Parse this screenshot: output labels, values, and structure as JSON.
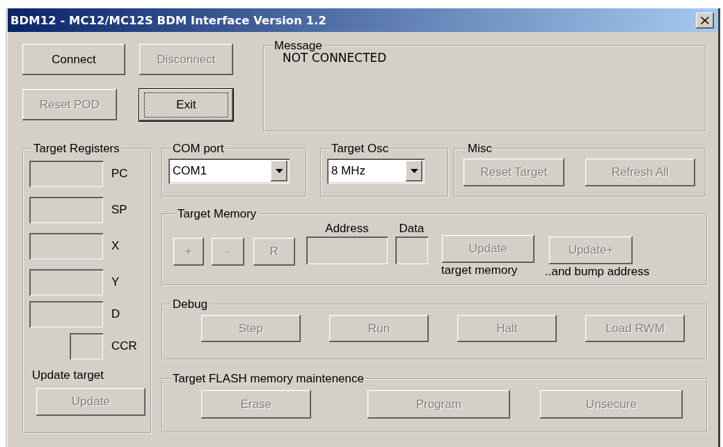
{
  "window": {
    "title": "BDM12 - MC12/MC12S BDM Interface Version 1.2"
  },
  "connection_buttons": [
    {
      "label": "Connect",
      "disabled": false,
      "focused": false
    },
    {
      "label": "Disconnect",
      "disabled": true,
      "focused": false
    },
    {
      "label": "Reset POD",
      "disabled": true,
      "focused": false
    },
    {
      "label": "Exit",
      "disabled": false,
      "focused": true
    }
  ],
  "message": {
    "title": "Message",
    "text": "NOT CONNECTED"
  },
  "target_registers": {
    "title": "Target Registers",
    "registers": [
      {
        "label": "PC",
        "kind": "word"
      },
      {
        "label": "SP",
        "kind": "word"
      },
      {
        "label": "X",
        "kind": "word"
      },
      {
        "label": "Y",
        "kind": "word"
      },
      {
        "label": "D",
        "kind": "word"
      },
      {
        "label": "CCR",
        "kind": "byte"
      }
    ],
    "update_label": "Update target",
    "update_button": {
      "label": "Update",
      "disabled": true
    }
  },
  "com_port": {
    "title": "COM port",
    "value": "COM1"
  },
  "target_osc": {
    "title": "Target Osc",
    "value": "8 MHz"
  },
  "misc": {
    "title": "Misc",
    "buttons": [
      {
        "label": "Reset Target",
        "disabled": true
      },
      {
        "label": "Refresh All",
        "disabled": true
      }
    ]
  },
  "target_memory": {
    "title": "Target Memory",
    "step_buttons": [
      {
        "label": "+",
        "disabled": true
      },
      {
        "label": "-",
        "disabled": true
      },
      {
        "label": "R",
        "disabled": true
      }
    ],
    "address_label": "Address",
    "data_label": "Data",
    "update_button": {
      "label": "Update",
      "disabled": true
    },
    "update_caption": "target memory",
    "update_plus_button": {
      "label": "Update+",
      "disabled": true
    },
    "update_plus_caption": "..and bump address"
  },
  "debug": {
    "title": "Debug",
    "buttons": [
      {
        "label": "Step",
        "disabled": true
      },
      {
        "label": "Run",
        "disabled": true
      },
      {
        "label": "Halt",
        "disabled": true
      },
      {
        "label": "Load RWM",
        "disabled": true
      }
    ]
  },
  "flash": {
    "title": "Target FLASH memory maintenence",
    "buttons": [
      {
        "label": "Erase",
        "disabled": true
      },
      {
        "label": "Program",
        "disabled": true
      },
      {
        "label": "Unsecure",
        "disabled": true
      }
    ]
  }
}
